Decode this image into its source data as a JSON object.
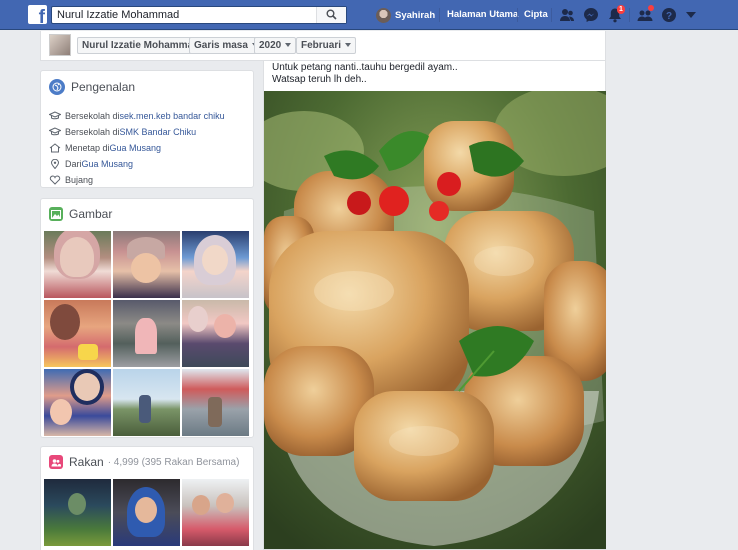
{
  "topbar": {
    "search_value": "Nurul Izzatie Mohammad",
    "user_name": "Syahirah",
    "home_label": "Halaman Utama",
    "create_label": "Cipta",
    "notif_badge": "1",
    "colors": {
      "bar": "#4267b2",
      "badge": "#fa3e3e"
    }
  },
  "profile_strip": {
    "name": "Nurul Izzatie Mohammad",
    "timeline_label": "Garis masa",
    "year_label": "2020",
    "month_label": "Februari"
  },
  "intro": {
    "title": "Pengenalan",
    "items": [
      {
        "icon": "graduation-cap-icon",
        "prefix": "Bersekolah di ",
        "link": "sek.men.keb bandar chiku"
      },
      {
        "icon": "graduation-cap-icon",
        "prefix": "Bersekolah di ",
        "link": "SMK Bandar Chiku"
      },
      {
        "icon": "home-icon",
        "prefix": "Menetap di ",
        "link": "Gua Musang"
      },
      {
        "icon": "location-pin-icon",
        "prefix": "Dari ",
        "link": "Gua Musang"
      },
      {
        "icon": "heart-icon",
        "prefix": "Bujang",
        "link": ""
      }
    ]
  },
  "photos": {
    "title": "Gambar"
  },
  "friends": {
    "title": "Rakan",
    "count_text": "· 4,999 (395 Rakan Bersama)"
  },
  "post": {
    "line1": "Untuk petang nanti..tauhu bergedil ayam..",
    "line2": "Watsap teruh lh deh.."
  }
}
